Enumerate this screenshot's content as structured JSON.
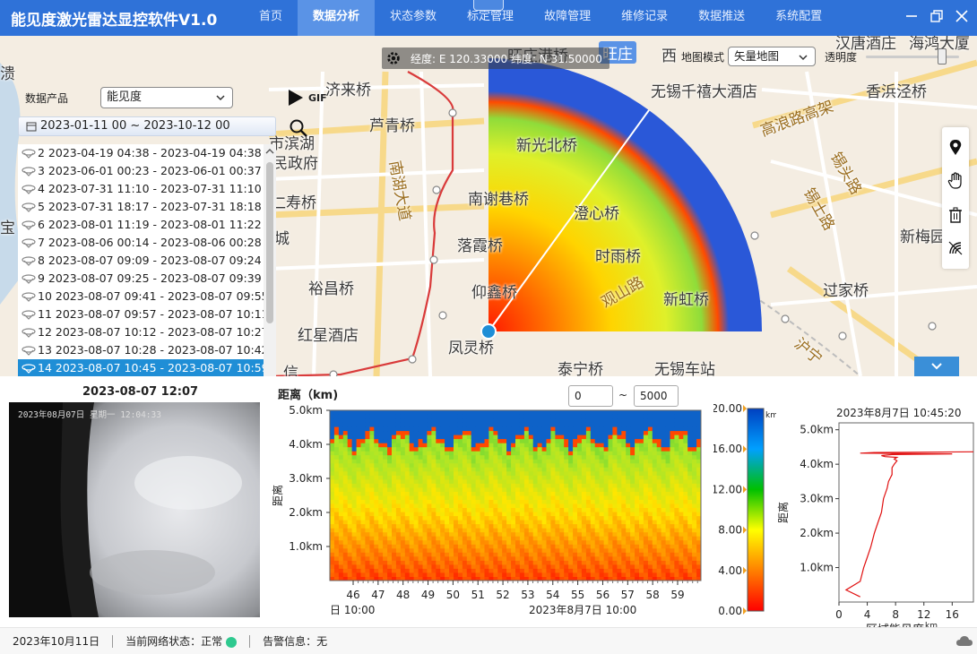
{
  "app": {
    "title": "能见度激光雷达显控软件V1.0"
  },
  "nav": [
    {
      "label": "首页",
      "active": false
    },
    {
      "label": "数据分析",
      "active": true
    },
    {
      "label": "状态参数",
      "active": false
    },
    {
      "label": "标定管理",
      "active": false
    },
    {
      "label": "故障管理",
      "active": false
    },
    {
      "label": "维修记录",
      "active": false
    },
    {
      "label": "数据推送",
      "active": false
    },
    {
      "label": "系统配置",
      "active": false
    }
  ],
  "map": {
    "coords": "经度: E 120.33000  纬度: N 31.50000",
    "mode_label": "地图模式",
    "mode_value": "矢量地图",
    "opacity_label": "透明度",
    "opacity_value": 0.85,
    "labels": {
      "l01": "济来桥",
      "l02": "芦青桥",
      "l03": "市滨湖",
      "l04": "民政府",
      "l05": "仁寿桥",
      "l06": "南谢巷桥",
      "l07": "落霞桥",
      "l08": "裕昌桥",
      "l09": "仰鑫桥",
      "l10": "红星酒店",
      "l11": "凤灵桥",
      "l12": "泰宁桥",
      "l13": "无锡千禧大酒店",
      "l14": "香浜泾桥",
      "l15": "高浪路高架",
      "l16": "新梅园",
      "l17": "过家桥",
      "l18": "锡士路",
      "l19": "南湖大道",
      "l20": "旺庄",
      "l21": "新光北桥",
      "l22": "澄心桥",
      "l23": "时雨桥",
      "l24": "观山路",
      "l25": "新虹桥",
      "l26": "城",
      "l27": "溃",
      "l28": "宝",
      "l29": "旺庄港桥",
      "l30": "西",
      "l31": "汉唐酒庄",
      "l32": "海鸿大厦",
      "l33": "锡头路",
      "l34": "沪宁",
      "l35": "信",
      "l36": "无锡车站"
    }
  },
  "panel": {
    "product_label": "数据产品",
    "product_value": "能见度",
    "gif_label": "GIF",
    "date_range": "2023-01-11 00 ~ 2023-10-12 00",
    "records": [
      "2 2023-04-19 04:38 - 2023-04-19 04:38",
      "3 2023-06-01 00:23 - 2023-06-01 00:37",
      "4 2023-07-31 11:10 - 2023-07-31 11:10",
      "5 2023-07-31 18:17 - 2023-07-31 18:18",
      "6 2023-08-01 11:19 - 2023-08-01 11:22",
      "7 2023-08-06 00:14 - 2023-08-06 00:28",
      "8 2023-08-07 09:09 - 2023-08-07 09:24",
      "9 2023-08-07 09:25 - 2023-08-07 09:39",
      "10 2023-08-07 09:41 - 2023-08-07 09:55",
      "11 2023-08-07 09:57 - 2023-08-07 10:11",
      "12 2023-08-07 10:12 - 2023-08-07 10:27",
      "13 2023-08-07 10:28 - 2023-08-07 10:42",
      "14 2023-08-07 10:45 - 2023-08-07 10:59",
      "15 2023-08-07 11:01 - 2023-08-07 11:15"
    ],
    "selected_record": "14 2023-08-07 10:45 - 2023-08-07 10:59"
  },
  "camera": {
    "time": "2023-08-07 12:07",
    "overlay": "2023年08月07日 星期一 12:04:33"
  },
  "distance_chart": {
    "title": "距离（km)",
    "range_min": "0",
    "range_sep": "~",
    "range_max": "5000"
  },
  "chart_data": [
    {
      "type": "heatmap",
      "ylabel": "距离",
      "y_ticks": [
        "1.0km",
        "2.0km",
        "3.0km",
        "4.0km",
        "5.0km"
      ],
      "x_ticks": [
        "46",
        "47",
        "48",
        "49",
        "50",
        "51",
        "52",
        "53",
        "54",
        "55",
        "56",
        "57",
        "58",
        "59"
      ],
      "x_caption_left": "日 10:00",
      "x_caption_right": "2023年8月7日  10:00",
      "ylim": [
        0,
        5
      ],
      "colorbar": {
        "ticks": [
          "20.00",
          "16.00",
          "12.00",
          "8.00",
          "4.00",
          "0.00"
        ],
        "unit": "km",
        "range": [
          0,
          20
        ],
        "colors": [
          "#ff0000",
          "#ff8000",
          "#ffff00",
          "#00c000",
          "#00a0ff",
          "#0040c0"
        ]
      }
    },
    {
      "type": "line",
      "title": "2023年8月7日 10:45:20",
      "xlabel": "区域能见度",
      "xlabel_unit": "km",
      "ylabel": "距离",
      "x_ticks": [
        "0",
        "4",
        "8",
        "12",
        "16"
      ],
      "y_ticks": [
        "1.0km",
        "2.0km",
        "3.0km",
        "4.0km",
        "5.0km"
      ],
      "xlim": [
        0,
        19
      ],
      "ylim": [
        0,
        5.2
      ],
      "series": [
        {
          "x": [
            3.0,
            1.0,
            3.0,
            3.5,
            4.0,
            4.5,
            5.0,
            5.5,
            6.0,
            6.3,
            6.8,
            7.0,
            7.5,
            7.5,
            7.8,
            8.0,
            8.2,
            7.8,
            8.2,
            6.5,
            6.0,
            7.5,
            16.0,
            3.0,
            5.0,
            19.0
          ],
          "y": [
            0.15,
            0.35,
            0.6,
            1.0,
            1.3,
            1.6,
            2.0,
            2.3,
            2.6,
            3.0,
            3.3,
            3.5,
            3.7,
            3.9,
            4.0,
            4.05,
            4.1,
            4.15,
            4.2,
            4.22,
            4.25,
            4.28,
            4.3,
            4.32,
            4.34,
            4.36
          ]
        }
      ]
    }
  ],
  "status": {
    "date": "2023年10月11日",
    "net_label": "当前网络状态：正常",
    "alarm_label": "告警信息：无"
  }
}
